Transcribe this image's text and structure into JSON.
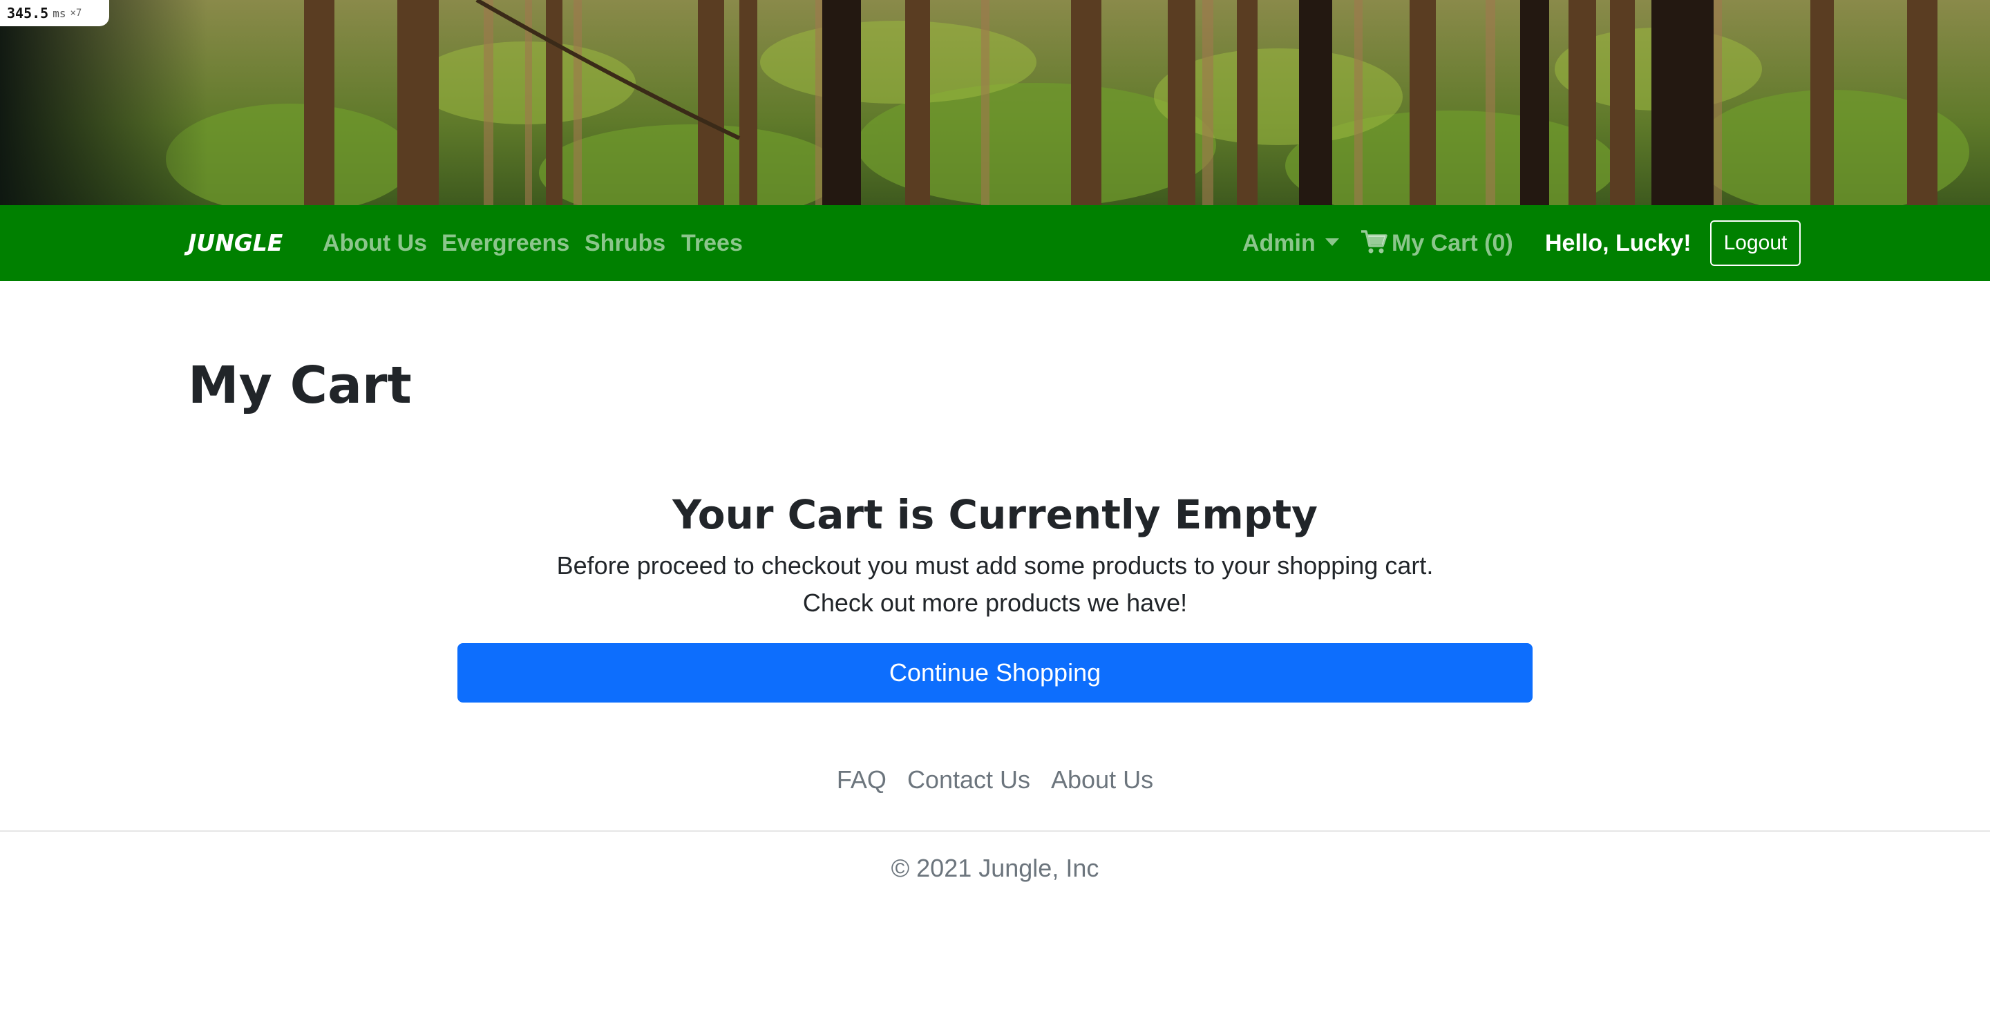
{
  "perf": {
    "value": "345.5",
    "unit": "ms",
    "multiplier": "×7"
  },
  "navbar": {
    "brand": "JUNGLE",
    "links": [
      "About Us",
      "Evergreens",
      "Shrubs",
      "Trees"
    ],
    "admin_label": "Admin",
    "cart_label": "My Cart (0)",
    "greeting": "Hello, Lucky!",
    "logout_label": "Logout",
    "background_color": "#008000"
  },
  "main": {
    "title": "My Cart",
    "empty_heading": "Your Cart is Currently Empty",
    "empty_line_1": "Before proceed to checkout you must add some products to your shopping cart.",
    "empty_line_2": "Check out more products we have!",
    "continue_label": "Continue Shopping",
    "button_color": "#0d6efd"
  },
  "footer": {
    "links": [
      "FAQ",
      "Contact Us",
      "About Us"
    ],
    "copyright": "© 2021 Jungle, Inc"
  }
}
